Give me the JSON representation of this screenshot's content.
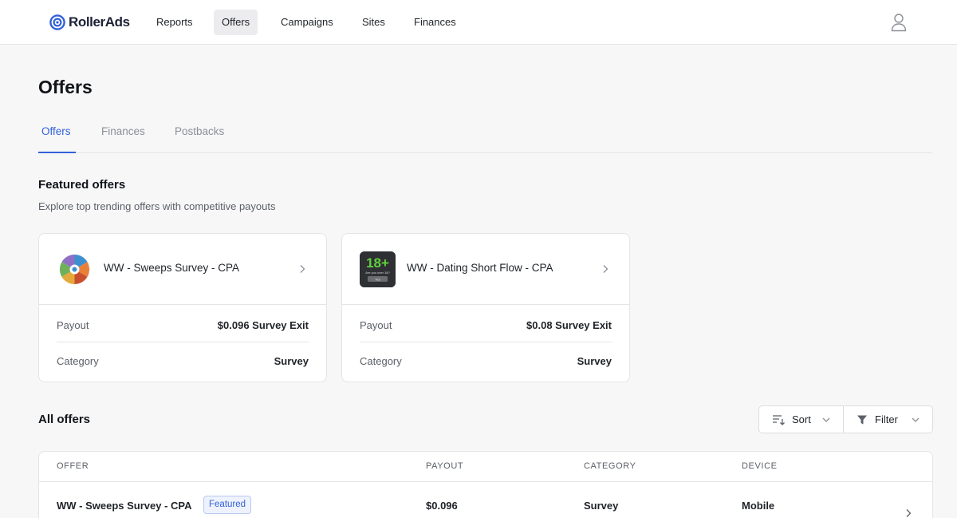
{
  "app": {
    "brand": "RollerAds",
    "nav": [
      {
        "label": "Reports",
        "active": false
      },
      {
        "label": "Offers",
        "active": true
      },
      {
        "label": "Campaigns",
        "active": false
      },
      {
        "label": "Sites",
        "active": false
      },
      {
        "label": "Finances",
        "active": false
      }
    ],
    "user_icon": "user-icon"
  },
  "page": {
    "title": "Offers",
    "tabs": [
      {
        "label": "Offers",
        "active": true
      },
      {
        "label": "Finances",
        "active": false
      },
      {
        "label": "Postbacks",
        "active": false
      }
    ]
  },
  "featured": {
    "title": "Featured offers",
    "subtitle": "Explore top trending offers with competitive payouts",
    "cards": [
      {
        "name": "WW - Sweeps Survey - CPA",
        "thumb_icon": "prize-wheel-icon",
        "payout_label": "Payout",
        "payout_value": "$0.096 Survey Exit",
        "category_label": "Category",
        "category_value": "Survey"
      },
      {
        "name": "WW - Dating Short Flow - CPA",
        "thumb_icon": "age-18-plus-icon",
        "thumb_text": "18+",
        "thumb_caption": "Are you over 18?",
        "thumb_button": "Yes",
        "payout_label": "Payout",
        "payout_value": "$0.08 Survey Exit",
        "category_label": "Category",
        "category_value": "Survey"
      }
    ]
  },
  "all_offers": {
    "title": "All offers",
    "sort_label": "Sort",
    "filter_label": "Filter",
    "columns": [
      "Offer",
      "Payout",
      "Category",
      "Device"
    ],
    "rows": [
      {
        "offer": "WW - Sweeps Survey - CPA",
        "badge": "Featured",
        "payout": "$0.096",
        "category": "Survey",
        "device": "Mobile"
      }
    ]
  },
  "colors": {
    "accent": "#3461d9",
    "badge_bg": "#eef2fc",
    "page_bg": "#f7f7f8",
    "thumb_dark": "#2f3033",
    "thumb_green": "#5fd13c"
  }
}
